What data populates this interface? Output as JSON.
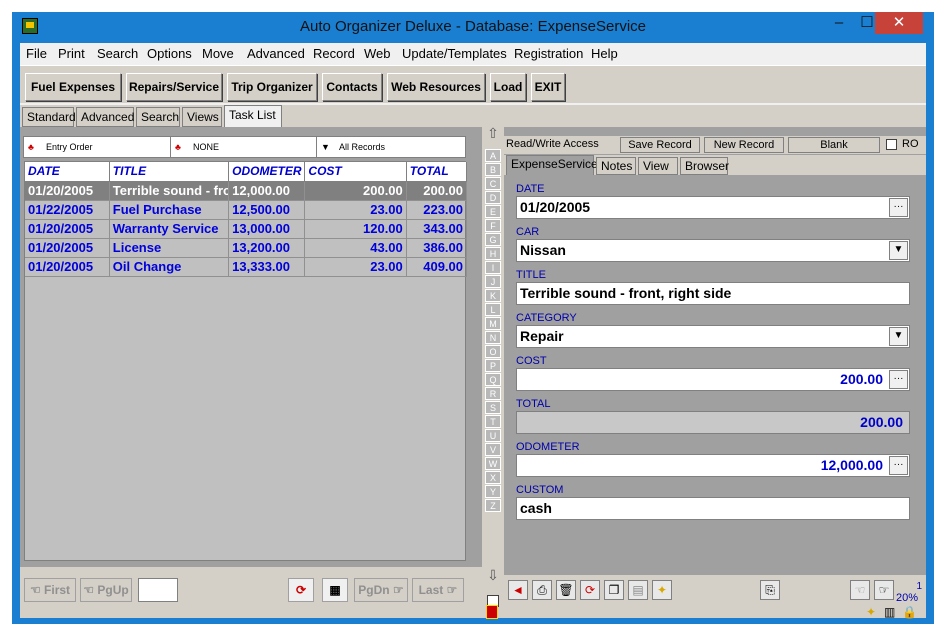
{
  "window": {
    "title": "Auto Organizer Deluxe - Database: ExpenseService",
    "min": "–",
    "max": "☐",
    "close": "✕"
  },
  "menu": [
    "File",
    "Print",
    "Search",
    "Options",
    "Move",
    "Advanced",
    "Record",
    "Web",
    "Update/Templates",
    "Registration",
    "Help"
  ],
  "toolbar": [
    "Fuel Expenses",
    "Repairs/Service",
    "Trip Organizer",
    "Contacts",
    "Web Resources",
    "Load",
    "EXIT"
  ],
  "left_tabs": [
    "Standard",
    "Advanced",
    "Search",
    "Views",
    "Task List"
  ],
  "list_header": {
    "order": "Entry Order",
    "filter": "NONE",
    "records": "All Records"
  },
  "grid": {
    "columns": [
      "DATE",
      "TITLE",
      "ODOMETER",
      "COST",
      "TOTAL"
    ],
    "rows": [
      [
        "01/20/2005",
        "Terrible sound - front",
        "12,000.00",
        "200.00",
        "200.00"
      ],
      [
        "01/22/2005",
        "Fuel Purchase",
        "12,500.00",
        "23.00",
        "223.00"
      ],
      [
        "01/20/2005",
        "Warranty Service",
        "13,000.00",
        "120.00",
        "343.00"
      ],
      [
        "01/20/2005",
        "License",
        "13,200.00",
        "43.00",
        "386.00"
      ],
      [
        "01/20/2005",
        "Oil Change",
        "13,333.00",
        "23.00",
        "409.00"
      ]
    ]
  },
  "nav": {
    "first": "First",
    "pgup": "PgUp",
    "pgdn": "PgDn",
    "last": "Last"
  },
  "alphabet": [
    "A",
    "B",
    "C",
    "D",
    "E",
    "F",
    "G",
    "H",
    "I",
    "J",
    "K",
    "L",
    "M",
    "N",
    "O",
    "P",
    "Q",
    "R",
    "S",
    "T",
    "U",
    "V",
    "W",
    "X",
    "Y",
    "Z"
  ],
  "right_head": {
    "access": "Read/Write Access",
    "save": "Save Record",
    "new": "New Record",
    "blank": "Blank",
    "ro": "RO"
  },
  "right_tabs": [
    "ExpenseService",
    "Notes",
    "View",
    "Browser"
  ],
  "form": {
    "date_label": "DATE",
    "date": "01/20/2005",
    "car_label": "CAR",
    "car": "Nissan",
    "title_label": "TITLE",
    "title": "Terrible sound - front, right side",
    "category_label": "CATEGORY",
    "category": "Repair",
    "cost_label": "COST",
    "cost": "200.00",
    "total_label": "TOTAL",
    "total": "200.00",
    "odometer_label": "ODOMETER",
    "odometer": "12,000.00",
    "custom_label": "CUSTOM",
    "custom": "cash"
  },
  "record_info": {
    "count": "1",
    "percent": "20%"
  }
}
